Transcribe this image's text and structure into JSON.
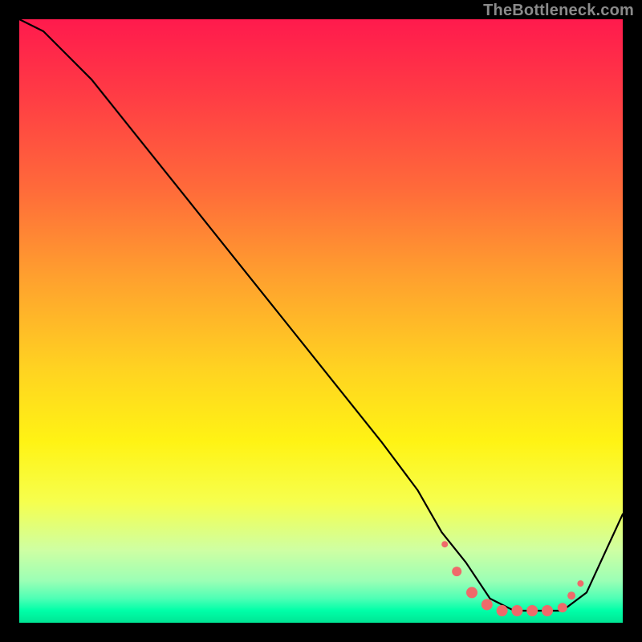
{
  "watermark": "TheBottleneck.com",
  "chart_data": {
    "type": "line",
    "title": "",
    "xlabel": "",
    "ylabel": "",
    "xlim": [
      0,
      100
    ],
    "ylim": [
      0,
      100
    ],
    "grid": false,
    "series": [
      {
        "name": "curve",
        "color": "#000000",
        "x": [
          0,
          4,
          8,
          12,
          20,
          28,
          36,
          44,
          52,
          60,
          66,
          70,
          74,
          78,
          82,
          86,
          90,
          94,
          100
        ],
        "y": [
          100,
          98,
          94,
          90,
          80,
          70,
          60,
          50,
          40,
          30,
          22,
          15,
          10,
          4,
          2,
          2,
          2,
          5,
          18
        ]
      }
    ],
    "markers": {
      "name": "highlight-dots",
      "color": "#ef6a6a",
      "points": [
        {
          "x": 70.5,
          "y": 13.0,
          "r": 4
        },
        {
          "x": 72.5,
          "y": 8.5,
          "r": 6
        },
        {
          "x": 75.0,
          "y": 5.0,
          "r": 7
        },
        {
          "x": 77.5,
          "y": 3.0,
          "r": 7
        },
        {
          "x": 80.0,
          "y": 2.0,
          "r": 7
        },
        {
          "x": 82.5,
          "y": 2.0,
          "r": 7
        },
        {
          "x": 85.0,
          "y": 2.0,
          "r": 7
        },
        {
          "x": 87.5,
          "y": 2.0,
          "r": 7
        },
        {
          "x": 90.0,
          "y": 2.5,
          "r": 6
        },
        {
          "x": 91.5,
          "y": 4.5,
          "r": 5
        },
        {
          "x": 93.0,
          "y": 6.5,
          "r": 4
        }
      ]
    },
    "gradient_stops": [
      {
        "p": 0,
        "c": "#ff1a4d"
      },
      {
        "p": 12,
        "c": "#ff3a45"
      },
      {
        "p": 28,
        "c": "#ff6a3a"
      },
      {
        "p": 43,
        "c": "#ffa12e"
      },
      {
        "p": 58,
        "c": "#ffd321"
      },
      {
        "p": 70,
        "c": "#fff314"
      },
      {
        "p": 80,
        "c": "#f6ff4e"
      },
      {
        "p": 88,
        "c": "#ceffa3"
      },
      {
        "p": 93,
        "c": "#9cffb5"
      },
      {
        "p": 96,
        "c": "#4dffb5"
      },
      {
        "p": 98,
        "c": "#00ffa8"
      },
      {
        "p": 100,
        "c": "#00e594"
      }
    ]
  }
}
